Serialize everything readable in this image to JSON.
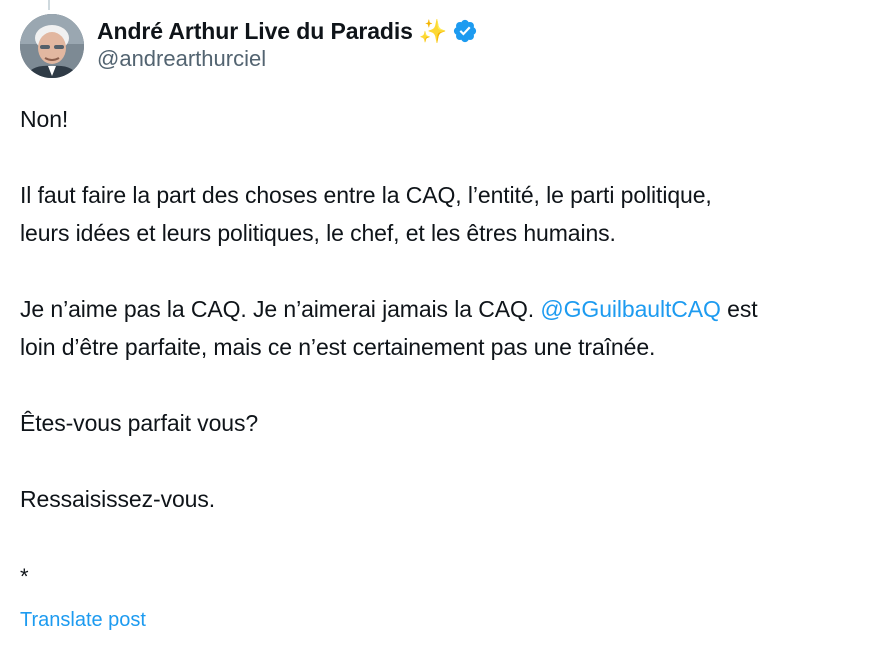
{
  "author": {
    "display_name": "André Arthur Live du Paradis",
    "emoji": "✨",
    "verified_icon": "verified-badge-icon",
    "handle": "@andrearthurciel",
    "avatar_icon": "profile-photo"
  },
  "post": {
    "line_1": "Non!",
    "line_2a": "Il faut faire la part des choses entre la CAQ, l’entité, le parti politique,",
    "line_2b": "leurs idées et leurs politiques, le chef, et les êtres humains.",
    "line_3a_before": "Je n’aime pas la CAQ. Je n’aimerai jamais la CAQ. ",
    "line_3a_mention": "@GGuilbaultCAQ",
    "line_3a_after": " est",
    "line_3b": "loin d’être parfaite, mais ce n’est certainement pas une traînée.",
    "line_4": "Êtes-vous parfait vous?",
    "line_5": "Ressaisissez-vous.",
    "line_6": "*"
  },
  "actions": {
    "translate_label": "Translate post"
  },
  "colors": {
    "text": "#0f1419",
    "secondary": "#536471",
    "accent": "#1d9bf0"
  }
}
